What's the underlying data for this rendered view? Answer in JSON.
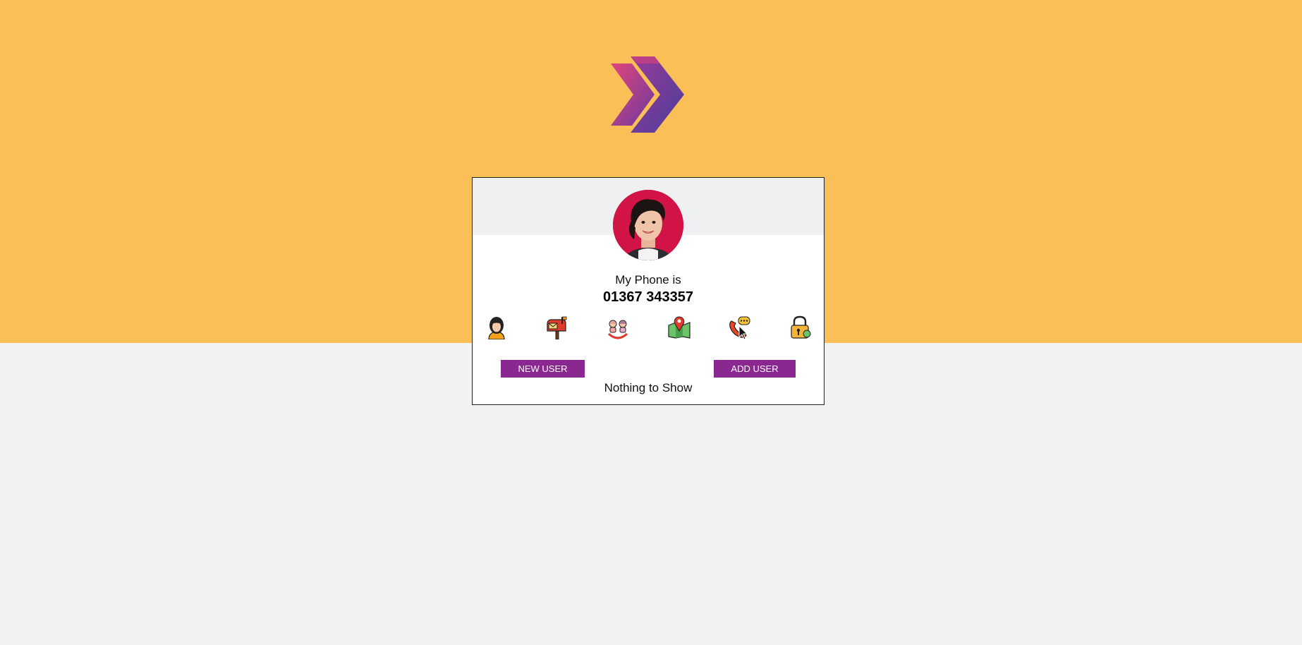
{
  "profile": {
    "title": "My Phone is",
    "value": "01367 343357"
  },
  "icons": [
    {
      "name": "user-icon",
      "active": false
    },
    {
      "name": "mailbox-icon",
      "active": false
    },
    {
      "name": "birthday-icon",
      "active": false
    },
    {
      "name": "map-location-icon",
      "active": false
    },
    {
      "name": "phone-icon",
      "active": true
    },
    {
      "name": "lock-icon",
      "active": false
    }
  ],
  "actions": {
    "new_user_label": "NEW USER",
    "add_user_label": "ADD USER"
  },
  "users_list": {
    "empty_message": "Nothing to Show"
  },
  "colors": {
    "top_band": "#fbbf58",
    "bottom_band": "#f2f2f2",
    "button": "#8b2790",
    "logo_primary": "#7a3d9e",
    "logo_secondary": "#d8437f"
  }
}
